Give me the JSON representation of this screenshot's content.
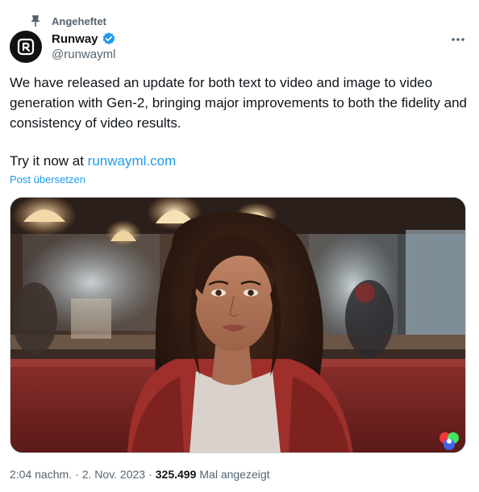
{
  "pinned": {
    "label": "Angeheftet",
    "icon": "pin-icon"
  },
  "author": {
    "name": "Runway",
    "handle": "@runwayml",
    "verified": true,
    "avatar_icon": "runway-logo"
  },
  "tweet": {
    "text_line1": "We have released an update for both text to video and image to video generation with Gen-2, bringing major improvements to both the fidelity and consistency of video results.",
    "text_prefix": "Try it now at ",
    "link_text": "runwayml.com"
  },
  "translate_label": "Post übersetzen",
  "media": {
    "kind": "photo",
    "badge_icon": "color-wheel-icon"
  },
  "meta": {
    "time": "2:04 nachm.",
    "separator": "·",
    "date": "2. Nov. 2023",
    "views_count": "325.499",
    "views_label": "Mal angezeigt"
  },
  "colors": {
    "text_primary": "#0f1419",
    "text_secondary": "#536471",
    "link": "#1d9bf0",
    "verified": "#1d9bf0"
  }
}
